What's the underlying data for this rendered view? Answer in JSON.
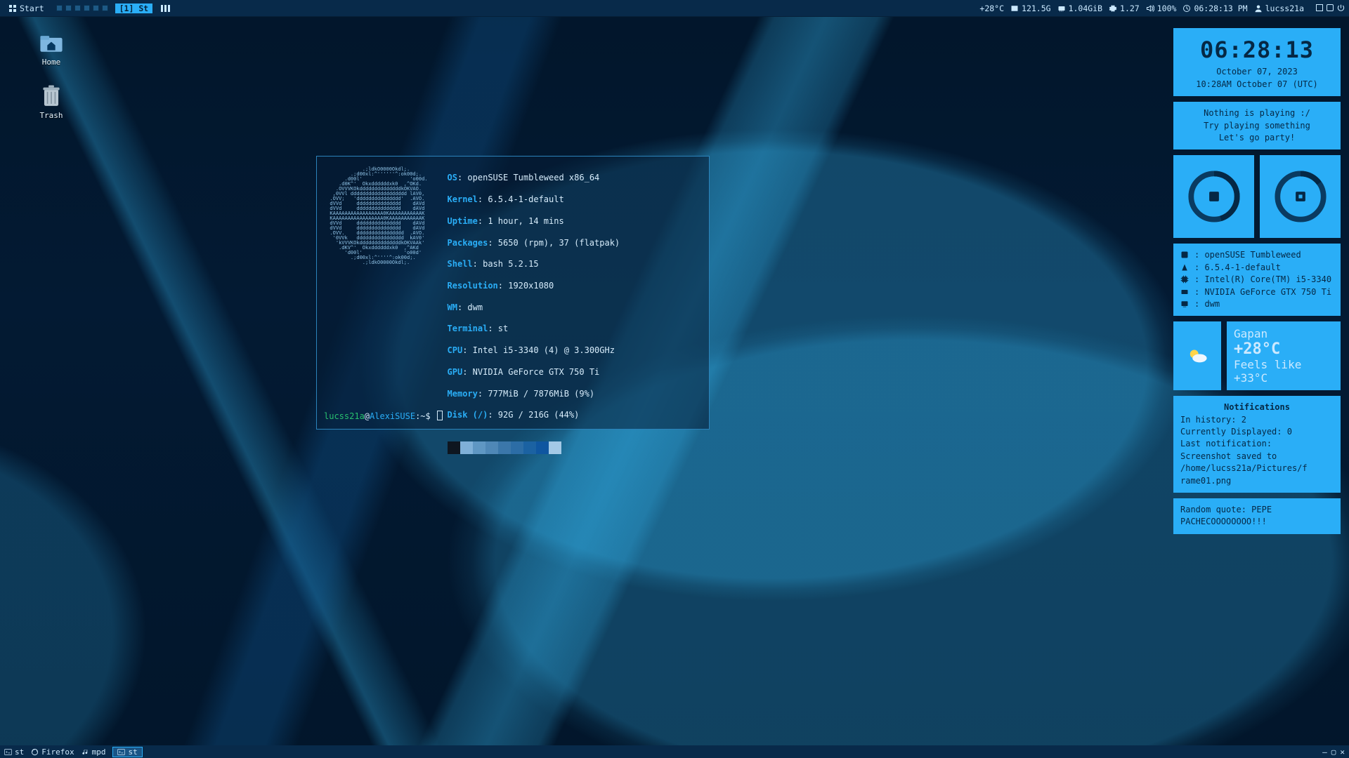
{
  "topbar": {
    "start_label": "Start",
    "tag": "[1] St",
    "temp": "+28°C",
    "storage": "121.5G",
    "ram": "1.04GiB",
    "load": "1.27",
    "volume": "100%",
    "clock": "06:28:13 PM",
    "user": "lucss21a"
  },
  "desktop": {
    "home": "Home",
    "trash": "Trash"
  },
  "neofetch": {
    "os": "openSUSE Tumbleweed x86_64",
    "kernel": "6.5.4-1-default",
    "uptime": "1 hour, 14 mins",
    "packages": "5650 (rpm), 37 (flatpak)",
    "shell": "bash 5.2.15",
    "resolution": "1920x1080",
    "wm": "dwm",
    "terminal": "st",
    "cpu": "Intel i5-3340 (4) @ 3.300GHz",
    "gpu": "NVIDIA GeForce GTX 750 Ti",
    "memory": "777MiB / 7876MiB (9%)",
    "disk": "92G / 216G (44%)",
    "swatch_colors": [
      "#0e1620",
      "#7fb0d8",
      "#5f97c3",
      "#4f88b7",
      "#3b77aa",
      "#2c6da6",
      "#1b62a2",
      "#0f56a0",
      "#a3c9e6"
    ]
  },
  "prompt": {
    "user": "lucss21a",
    "host": "AlexiSUSE",
    "cwd": "~",
    "symbol": "$"
  },
  "conky": {
    "clock": "06:28:13",
    "date_local": "October 07, 2023",
    "date_utc": "10:28AM October 07 (UTC)",
    "np1": "Nothing is playing :/",
    "np2": "Try playing something",
    "np3": "Let's go party!",
    "ram_pct": 45,
    "cpu_pct": 15,
    "os": "openSUSE Tumbleweed",
    "kernel": "6.5.4-1-default",
    "cpu": "Intel(R) Core(TM) i5-3340",
    "gpu": "NVIDIA GeForce GTX 750 Ti",
    "wm": "dwm",
    "wx_city": "Gapan",
    "wx_temp": "+28°C",
    "wx_feels": "Feels like +33°C",
    "notif_title": "Notifications",
    "notif_hist": "In history: 2",
    "notif_disp": "Currently Displayed: 0",
    "notif_last": "Last notification:",
    "notif_body1": "Screenshot saved to",
    "notif_body2": "/home/lucss21a/Pictures/f",
    "notif_body3": "rame01.png",
    "quote": "Random quote: PEPE PACHECOOOOOOOO!!!"
  },
  "taskbar": {
    "t1": "st",
    "t2": "Firefox",
    "t3": "mpd",
    "active": "st"
  }
}
